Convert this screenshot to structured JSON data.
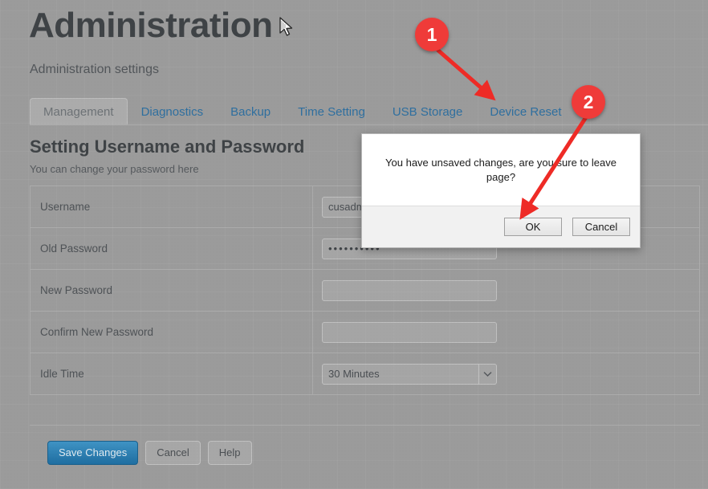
{
  "header": {
    "title": "Administration",
    "subtitle": "Administration settings"
  },
  "tabs": [
    {
      "label": "Management",
      "active": true
    },
    {
      "label": "Diagnostics",
      "active": false
    },
    {
      "label": "Backup",
      "active": false
    },
    {
      "label": "Time Setting",
      "active": false
    },
    {
      "label": "USB Storage",
      "active": false
    },
    {
      "label": "Device Reset",
      "active": false
    }
  ],
  "section": {
    "title": "Setting Username and Password",
    "subtitle": "You can change your password here"
  },
  "form": {
    "rows": [
      {
        "label": "Username",
        "type": "text",
        "value": "cusadmin",
        "placeholder": ""
      },
      {
        "label": "Old Password",
        "type": "password",
        "value": "••••••••••",
        "placeholder": ""
      },
      {
        "label": "New Password",
        "type": "password",
        "value": "",
        "placeholder": ""
      },
      {
        "label": "Confirm New Password",
        "type": "password",
        "value": "",
        "placeholder": ""
      },
      {
        "label": "Idle Time",
        "type": "select",
        "value": "30 Minutes",
        "placeholder": ""
      }
    ]
  },
  "footer": {
    "save_label": "Save Changes",
    "cancel_label": "Cancel",
    "help_label": "Help"
  },
  "dialog": {
    "message": "You have unsaved changes, are you sure to leave page?",
    "ok_label": "OK",
    "cancel_label": "Cancel"
  },
  "annotations": [
    {
      "number": "1",
      "target": "Device Reset tab"
    },
    {
      "number": "2",
      "target": "OK button"
    }
  ],
  "colors": {
    "accent": "#2f6f9f",
    "primary_button": "#2b79ab",
    "annotation": "#ef3b39",
    "page_background": "#9b9b9b",
    "dialog_background": "#ffffff"
  }
}
